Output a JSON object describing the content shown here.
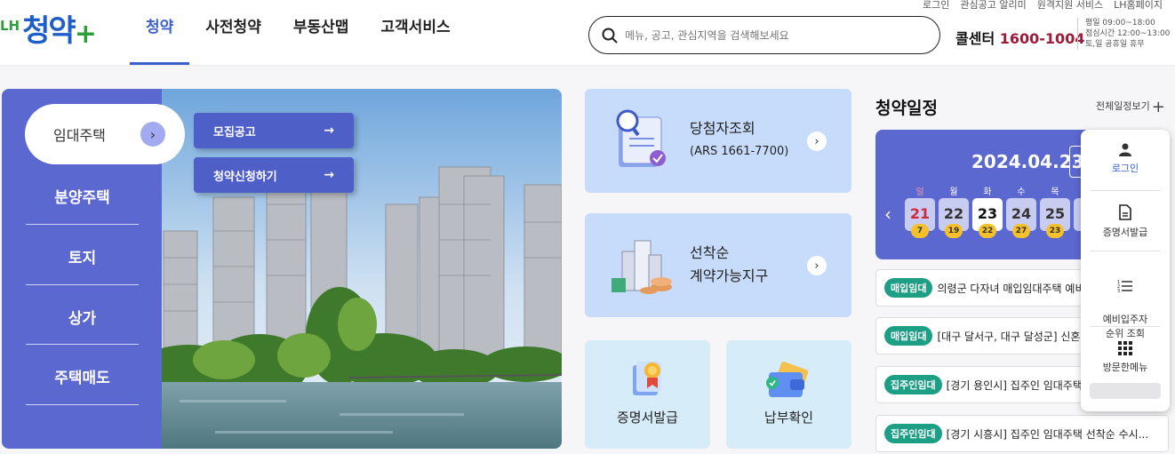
{
  "header": {
    "logo_prefix": "LH",
    "logo_main": "청약",
    "logo_plus": "+",
    "top_links": [
      "로그인",
      "관심공고 알리미",
      "원격지원 서비스",
      "LH홈페이지"
    ],
    "nav": [
      "청약",
      "사전청약",
      "부동산맵",
      "고객서비스"
    ],
    "search_placeholder": "메뉴, 공고, 관심지역을 검색해보세요",
    "callcenter_label": "콜센터",
    "callcenter_number": "1600-1004",
    "hours": [
      "평일 09:00~18:00",
      "점심시간 12:00~13:00",
      "토,일 공휴일 휴무"
    ]
  },
  "lnb": {
    "active": "임대주택",
    "items": [
      "분양주택",
      "토지",
      "상가",
      "주택매도"
    ],
    "sub_buttons": [
      "모집공고",
      "청약신청하기"
    ]
  },
  "cards": {
    "winner_title": "당첨자조회",
    "winner_sub": "(ARS 1661-7700)",
    "first_come_line1": "선착순",
    "first_come_line2": "계약가능지구",
    "certificate": "증명서발급",
    "payment": "납부확인"
  },
  "schedule": {
    "title": "청약일정",
    "view_all": "전체일정보기",
    "date": "2024.04.23",
    "weekdays": [
      "일",
      "월",
      "화",
      "수",
      "목"
    ],
    "days": [
      {
        "day": "21",
        "count": "7"
      },
      {
        "day": "22",
        "count": "19"
      },
      {
        "day": "23",
        "count": "22"
      },
      {
        "day": "24",
        "count": "27"
      },
      {
        "day": "25",
        "count": "23"
      }
    ],
    "notices": [
      {
        "badge": "매입임대",
        "text": "의령군 다자녀 매입임대주택 예비..."
      },
      {
        "badge": "매입임대",
        "text": "[대구 달서구, 대구 달성군] 신혼..."
      },
      {
        "badge": "집주인임대",
        "text": "[경기 용인시] 집주인 임대주택..."
      },
      {
        "badge": "집주인임대",
        "text": "[경기 시흥시] 집주인 임대주택 선착순 수시..."
      }
    ]
  },
  "quick_menu": {
    "items": [
      "로그인",
      "증명서발급",
      "예비입주자\n순위 조회",
      "방문한메뉴"
    ]
  },
  "colors": {
    "brand_blue": "#5b68cf",
    "nav_active": "#3b5fcf",
    "callcenter": "#9e1a36",
    "badge_green": "#1d9f85",
    "count_yellow": "#f5c02a"
  }
}
